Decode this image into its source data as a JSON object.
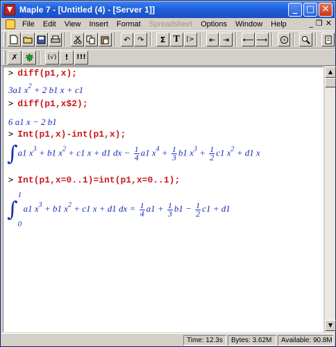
{
  "window": {
    "title": "Maple 7 - [Untitled (4) - [Server 1]]",
    "minimize_label": "_",
    "maximize_label": "□",
    "close_label": "✕"
  },
  "menubar": {
    "items": [
      {
        "label": "File"
      },
      {
        "label": "Edit"
      },
      {
        "label": "View"
      },
      {
        "label": "Insert"
      },
      {
        "label": "Format"
      },
      {
        "label": "Spreadsheet"
      },
      {
        "label": "Options"
      },
      {
        "label": "Window"
      },
      {
        "label": "Help"
      }
    ],
    "mdi_minimize": "_",
    "mdi_restore": "❐",
    "mdi_close": "✕"
  },
  "toolbar": {
    "sum_label": "Σ",
    "text_label": "T",
    "exec_label": "[>"
  },
  "context_bar": {
    "bang_label": "!",
    "triple_bang_label": "!!!",
    "paren_label": "(√)"
  },
  "worksheet": {
    "prompt": ">",
    "cmd1": "diff(p1,x);",
    "out1": {
      "c1": "3",
      "v1": "a1 x",
      "e1": "2",
      "rest": " + 2 b1 x + c1"
    },
    "cmd2": "diff(p1,x$2);",
    "out2": "6 a1 x − 2 b1",
    "cmd3": "Int(p1,x)-int(p1,x);",
    "out3": {
      "lhs_a": "a1 x",
      "lhs_a_exp": "3",
      "lhs_b": " + b1 x",
      "lhs_b_exp": "2",
      "lhs_rest": " + c1 x + d1 dx −",
      "f1_num": "1",
      "f1_den": "4",
      "t1": "a1 x",
      "t1_exp": "4",
      "plus1": " +",
      "f2_num": "1",
      "f2_den": "3",
      "t2": "b1 x",
      "t2_exp": "3",
      "plus2": " +",
      "f3_num": "1",
      "f3_den": "2",
      "t3": "c1 x",
      "t3_exp": "2",
      "tail": " + d1 x"
    },
    "cmd4": "Int(p1,x=0..1)=int(p1,x=0..1);",
    "out4": {
      "upper": "1",
      "lower": "0",
      "lhs_a": "a1 x",
      "lhs_a_exp": "3",
      "lhs_b": " + b1 x",
      "lhs_b_exp": "2",
      "lhs_rest": " + c1 x + d1 dx =",
      "f1_num": "1",
      "f1_den": "4",
      "t1": "a1 +",
      "f2_num": "1",
      "f2_den": "3",
      "t2": "b1 −",
      "f3_num": "1",
      "f3_den": "2",
      "t3": "c1 + d1"
    }
  },
  "statusbar": {
    "time": "Time: 12.3s",
    "bytes": "Bytes: 3.62M",
    "available": "Available: 90.8M"
  }
}
